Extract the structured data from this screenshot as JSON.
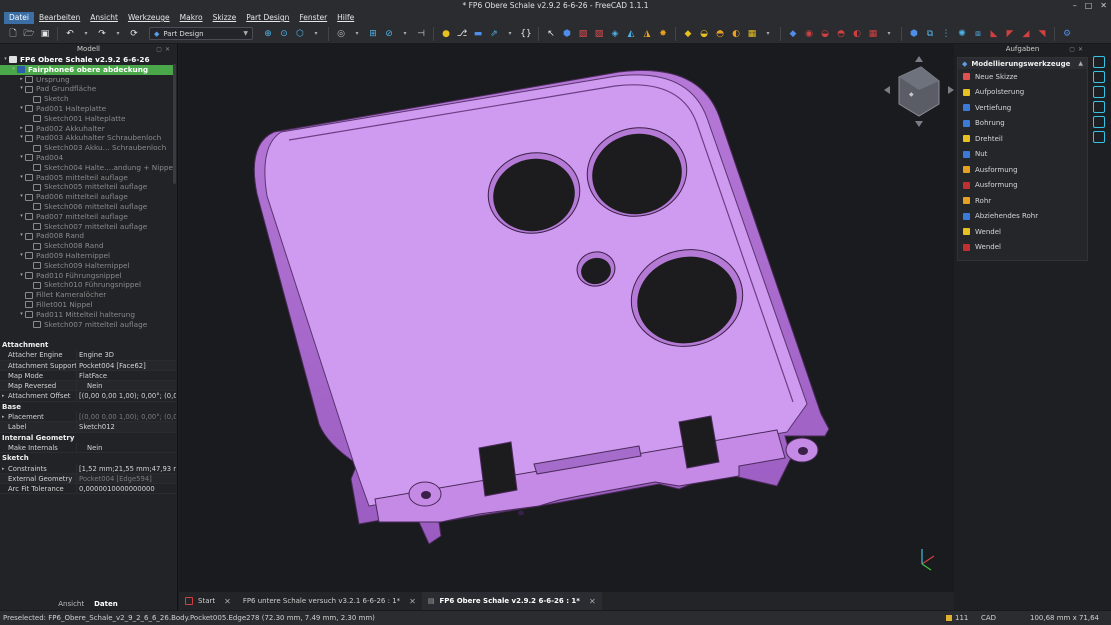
{
  "window": {
    "title": "* FP6 Obere Schale v2.9.2 6-6-26 - FreeCAD 1.1.1"
  },
  "menu": [
    "Datei",
    "Bearbeiten",
    "Ansicht",
    "Werkzeuge",
    "Makro",
    "Skizze",
    "Part Design",
    "Fenster",
    "Hilfe"
  ],
  "toolbar": {
    "workbench": "Part Design"
  },
  "left_panel": {
    "title": "Modell",
    "tree": [
      {
        "label": "FP6 Obere Schale v2.9.2 6-6-26",
        "indent": 0,
        "style": "root",
        "arrow": "▾"
      },
      {
        "label": "Fairphone6 obere abdeckung",
        "indent": 1,
        "style": "sel",
        "arrow": "▾"
      },
      {
        "label": "Ursprung",
        "indent": 2,
        "style": "dim",
        "arrow": "▸"
      },
      {
        "label": "Pad Grundfläche",
        "indent": 2,
        "style": "dim",
        "arrow": "▾"
      },
      {
        "label": "Sketch",
        "indent": 3,
        "style": "dim",
        "arrow": ""
      },
      {
        "label": "Pad001 Halteplatte",
        "indent": 2,
        "style": "dim",
        "arrow": "▾"
      },
      {
        "label": "Sketch001 Halteplatte",
        "indent": 3,
        "style": "dim",
        "arrow": ""
      },
      {
        "label": "Pad002 Akkuhalter",
        "indent": 2,
        "style": "dim",
        "arrow": "▸"
      },
      {
        "label": "Pad003 Akkuhalter Schraubenloch",
        "indent": 2,
        "style": "dim",
        "arrow": "▾"
      },
      {
        "label": "Sketch003 Akku... Schraubenloch",
        "indent": 3,
        "style": "dim",
        "arrow": ""
      },
      {
        "label": "Pad004",
        "indent": 2,
        "style": "dim",
        "arrow": "▾"
      },
      {
        "label": "Sketch004 Halte....andung + Nippel",
        "indent": 3,
        "style": "dim",
        "arrow": ""
      },
      {
        "label": "Pad005 mittelteil auflage",
        "indent": 2,
        "style": "dim",
        "arrow": "▾"
      },
      {
        "label": "Sketch005 mittelteil auflage",
        "indent": 3,
        "style": "dim",
        "arrow": ""
      },
      {
        "label": "Pad006 mittelteil auflage",
        "indent": 2,
        "style": "dim",
        "arrow": "▾"
      },
      {
        "label": "Sketch006 mittelteil auflage",
        "indent": 3,
        "style": "dim",
        "arrow": ""
      },
      {
        "label": "Pad007 mittelteil auflage",
        "indent": 2,
        "style": "dim",
        "arrow": "▾"
      },
      {
        "label": "Sketch007 mittelteil auflage",
        "indent": 3,
        "style": "dim",
        "arrow": ""
      },
      {
        "label": "Pad008 Rand",
        "indent": 2,
        "style": "dim",
        "arrow": "▾"
      },
      {
        "label": "Sketch008 Rand",
        "indent": 3,
        "style": "dim",
        "arrow": ""
      },
      {
        "label": "Pad009 Halternippel",
        "indent": 2,
        "style": "dim",
        "arrow": "▾"
      },
      {
        "label": "Sketch009 Halternippel",
        "indent": 3,
        "style": "dim",
        "arrow": ""
      },
      {
        "label": "Pad010 Führungsnippel",
        "indent": 2,
        "style": "dim",
        "arrow": "▾"
      },
      {
        "label": "Sketch010 Führungsnippel",
        "indent": 3,
        "style": "dim",
        "arrow": ""
      },
      {
        "label": "Fillet Kameralöcher",
        "indent": 2,
        "style": "dim",
        "arrow": ""
      },
      {
        "label": "Fillet001 Nippel",
        "indent": 2,
        "style": "dim",
        "arrow": ""
      },
      {
        "label": "Pad011 Mittelteil halterung",
        "indent": 2,
        "style": "dim",
        "arrow": "▾"
      },
      {
        "label": "Sketch007 mittelteil auflage",
        "indent": 3,
        "style": "dim",
        "arrow": ""
      }
    ],
    "properties": [
      {
        "group": "Attachment"
      },
      {
        "key": "Attacher Engine",
        "value": "Engine 3D"
      },
      {
        "key": "Attachment Support",
        "value": "Pocket004 [Face62]"
      },
      {
        "key": "Map Mode",
        "value": "FlatFace"
      },
      {
        "key": "Map Reversed",
        "value": "Nein",
        "center": true
      },
      {
        "key": "Attachment Offset",
        "value": "[(0,00 0,00 1,00); 0,00°; (0,00 ...",
        "tri": true
      },
      {
        "group": "Base"
      },
      {
        "key": "Placement",
        "value": "[(0,00 0,00 1,00); 0,00°; (0,00 ...",
        "tri": true,
        "dim": true
      },
      {
        "key": "Label",
        "value": "Sketch012"
      },
      {
        "group": "Internal Geometry"
      },
      {
        "key": "Make Internals",
        "value": "Nein",
        "center": true
      },
      {
        "group": "Sketch"
      },
      {
        "key": "Constraints",
        "value": "[1,52 mm;21,55 mm;47,93 m...",
        "tri": true
      },
      {
        "key": "External Geometry",
        "value": "Pocket004 [Edge594]",
        "dim": true
      },
      {
        "key": "Arc Fit Tolerance",
        "value": "0,0000010000000000"
      }
    ],
    "tabs": [
      "Ansicht",
      "Daten"
    ]
  },
  "tasks": {
    "title": "Aufgaben",
    "section": "Modellierungswerkzeuge",
    "items": [
      {
        "label": "Neue Skizze",
        "color": "#e05050"
      },
      {
        "label": "Aufpolsterung",
        "color": "#e8c020"
      },
      {
        "label": "Vertiefung",
        "color": "#3a7ad8"
      },
      {
        "label": "Bohrung",
        "color": "#3a7ad8"
      },
      {
        "label": "Drehteil",
        "color": "#e8c020"
      },
      {
        "label": "Nut",
        "color": "#3a7ad8"
      },
      {
        "label": "Ausformung",
        "color": "#e8a020"
      },
      {
        "label": "Ausformung",
        "color": "#c03030"
      },
      {
        "label": "Rohr",
        "color": "#e8a020"
      },
      {
        "label": "Abziehendes Rohr",
        "color": "#3a7ad8"
      },
      {
        "label": "Wendel",
        "color": "#e8c020"
      },
      {
        "label": "Wendel",
        "color": "#c03030"
      }
    ]
  },
  "doc_tabs": [
    {
      "label": "Start",
      "active": false
    },
    {
      "label": "FP6 untere Schale versuch v3.2.1  6-6-26 : 1*",
      "active": false
    },
    {
      "label": "FP6 Obere Schale v2.9.2 6-6-26 : 1*",
      "active": true
    }
  ],
  "status": {
    "preselected": "Preselected: FP6_Obere_Schale_v2_9_2_6_6_26.Body.Pocket005.Edge278 (72.30 mm, 7.49 mm, 2.30 mm)",
    "count": "111",
    "nav": "CAD",
    "dims": "100,68 mm x 71,64 mm"
  },
  "colors": {
    "part": "#c98ee8",
    "selection": "#4aa84a",
    "accent": "#3a6ea5"
  }
}
